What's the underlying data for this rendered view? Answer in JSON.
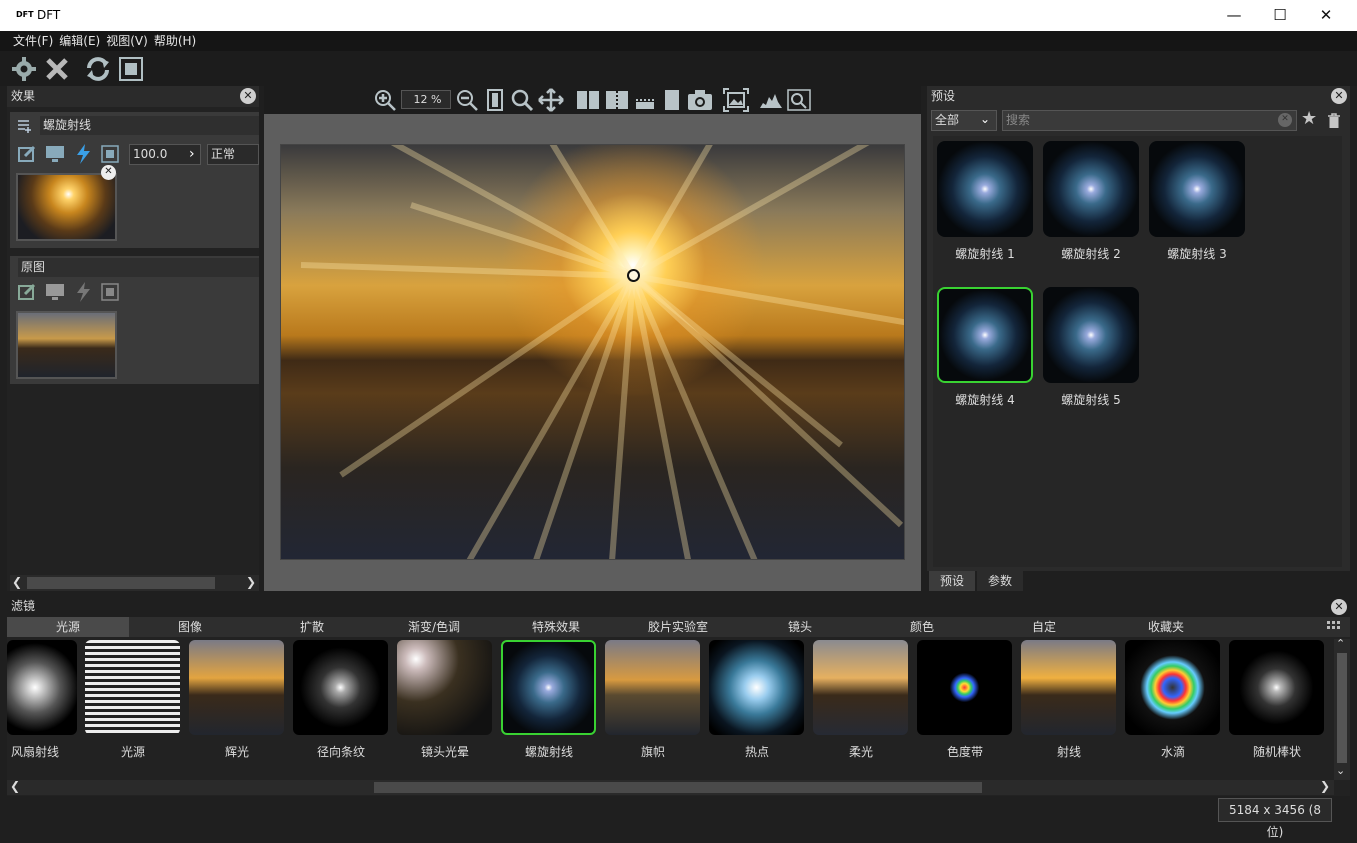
{
  "window": {
    "logo": "DFT",
    "title": "DFT",
    "min": "—",
    "max": "☐",
    "close": "✕"
  },
  "menu": [
    "文件(F)",
    "编辑(E)",
    "视图(V)",
    "帮助(H)"
  ],
  "toolbar_icons": [
    "gear-icon",
    "close-x-icon",
    "refresh-icon",
    "frame-icon"
  ],
  "effects": {
    "title": "效果",
    "layer1": {
      "name": "螺旋射线",
      "opacity": "100.0",
      "blend": "正常"
    },
    "layer2": {
      "name": "原图"
    }
  },
  "viewer": {
    "zoom": "12 %"
  },
  "presets": {
    "title": "预设",
    "filter": "全部",
    "search_placeholder": "搜索",
    "items": [
      "螺旋射线 1",
      "螺旋射线 2",
      "螺旋射线 3",
      "螺旋射线 4",
      "螺旋射线 5"
    ],
    "selected_index": 3,
    "tabs": [
      "预设",
      "参数"
    ]
  },
  "filters": {
    "title": "滤镜",
    "tabs": [
      "光源",
      "图像",
      "扩散",
      "渐变/色调",
      "特殊效果",
      "胶片实验室",
      "镜头",
      "颜色",
      "自定",
      "收藏夹"
    ],
    "active_tab": 0,
    "items": [
      "风扇射线",
      "光源",
      "辉光",
      "径向条纹",
      "镜头光晕",
      "螺旋射线",
      "旗帜",
      "热点",
      "柔光",
      "色度带",
      "射线",
      "水滴",
      "随机棒状"
    ],
    "selected_index": 5
  },
  "status": {
    "dimensions": "5184 x 3456 (8 位)"
  },
  "colors": {
    "selection": "#39d232",
    "panel": "#2b2b2b",
    "background": "#1f1f1f"
  }
}
